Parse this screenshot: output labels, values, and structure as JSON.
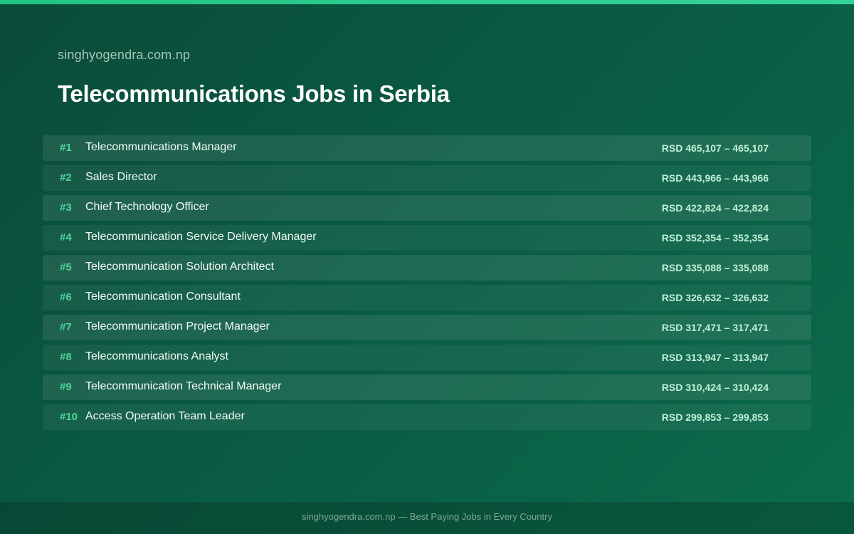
{
  "header": {
    "site": "singhyogendra.com.np",
    "title": "Telecommunications Jobs in Serbia"
  },
  "jobs": [
    {
      "rank": "#1",
      "title": "Telecommunications Manager",
      "salary": "RSD 465,107 – 465,107"
    },
    {
      "rank": "#2",
      "title": "Sales Director",
      "salary": "RSD 443,966 – 443,966"
    },
    {
      "rank": "#3",
      "title": "Chief Technology Officer",
      "salary": "RSD 422,824 – 422,824"
    },
    {
      "rank": "#4",
      "title": "Telecommunication Service Delivery Manager",
      "salary": "RSD 352,354 – 352,354"
    },
    {
      "rank": "#5",
      "title": "Telecommunication Solution Architect",
      "salary": "RSD 335,088 – 335,088"
    },
    {
      "rank": "#6",
      "title": "Telecommunication Consultant",
      "salary": "RSD 326,632 – 326,632"
    },
    {
      "rank": "#7",
      "title": "Telecommunication Project Manager",
      "salary": "RSD 317,471 – 317,471"
    },
    {
      "rank": "#8",
      "title": "Telecommunications Analyst",
      "salary": "RSD 313,947 – 313,947"
    },
    {
      "rank": "#9",
      "title": "Telecommunication Technical Manager",
      "salary": "RSD 310,424 – 310,424"
    },
    {
      "rank": "#10",
      "title": "Access Operation Team Leader",
      "salary": "RSD 299,853 – 299,853"
    }
  ],
  "footer": {
    "text": "singhyogendra.com.np — Best Paying Jobs in Every Country"
  },
  "colors": {
    "accent": "#34d399",
    "rank": "#4ed39a",
    "salary": "#bff0d5",
    "background": "#0a5a43"
  }
}
